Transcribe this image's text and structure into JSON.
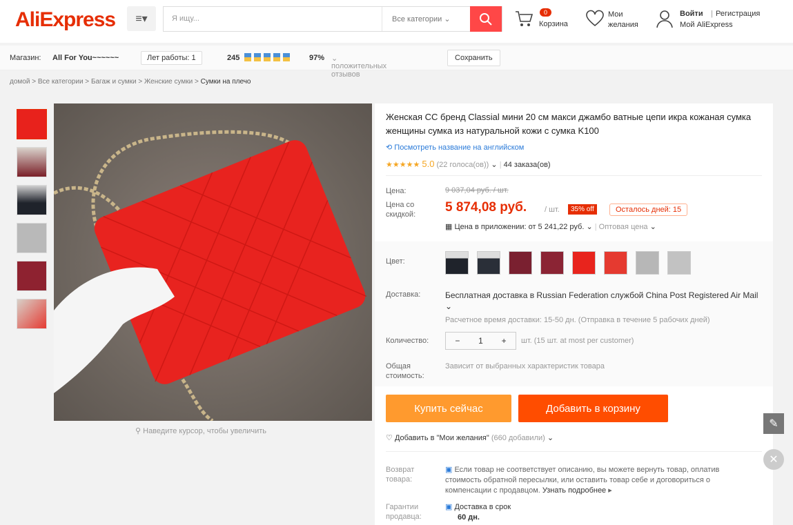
{
  "header": {
    "logo": "AliExpress",
    "search_placeholder": "Я ищу...",
    "category_select": "Все категории",
    "cart_count": "0",
    "cart_label": "Корзина",
    "wishlist_line1": "Мои",
    "wishlist_line2": "желания",
    "login": "Войти",
    "register": "Регистрация",
    "my_account": "Мой AliExpress"
  },
  "shop": {
    "label": "Магазин:",
    "name": "All For You~~~~~~",
    "years": "Лет работы: 1",
    "rating_count": "245",
    "positive": "97%",
    "positive_label": "положительных отзывов",
    "save": "Сохранить"
  },
  "breadcrumb": [
    "домой",
    "Все категории",
    "Багаж и сумки",
    "Женские сумки",
    "Сумки на плечо"
  ],
  "product": {
    "title": "Женская CC бренд Classial мини 20 см макси джамбо ватные цепи икра кожаная сумка женщины сумка из натуральной кожи с сумка K100",
    "translate_link": "Посмотреть название на английском",
    "stars": "★★★★★",
    "rating": "5.0",
    "votes": "(22 голоса(ов))",
    "orders": "44 заказа(ов)",
    "price_label": "Цена:",
    "old_price": "9 037,04 руб. / шт.",
    "discount_label": "Цена со скидкой:",
    "price": "5 874,08 руб.",
    "per_unit": "/ шт.",
    "discount_badge": "35% off",
    "days_left": "Осталось дней: 15",
    "app_price": "Цена в приложении: от 5 241,22 руб.",
    "wholesale": "Оптовая цена",
    "color_label": "Цвет:",
    "delivery_label": "Доставка:",
    "delivery_text": "Бесплатная доставка в Russian Federation службой China Post Registered Air Mail",
    "delivery_time": "Расчетное время доставки: 15-50 дн. (Отправка в течение 5 рабочих дней)",
    "qty_label": "Количество:",
    "qty_value": "1",
    "qty_note": "шт. (15 шт. at most per customer)",
    "total_label": "Общая стоимость:",
    "total_text": "Зависит от выбранных характеристик товара",
    "buy_now": "Купить сейчас",
    "add_cart": "Добавить в корзину",
    "wishlist": "Добавить в \"Мои желания\"",
    "wishlist_count": "(660 добавили)",
    "return_label": "Возврат товара:",
    "return_text": "Если товар не соответствует описанию, вы можете вернуть товар, оплатив стоимость обратной пересылки, или оставить товар себе и договориться о компенсации с продавцом.",
    "learn_more": "Узнать подробнее",
    "guarantee_label": "Гарантии продавца:",
    "guarantee_text": "Доставка в срок",
    "guarantee_days": "60 дн.",
    "zoom_hint": "Наведите курсор, чтобы увеличить"
  },
  "colors": {
    "accent": "#ff4747",
    "brand": "#e62e04",
    "buy": "#ff9a2e",
    "cart": "#ff4d00"
  }
}
